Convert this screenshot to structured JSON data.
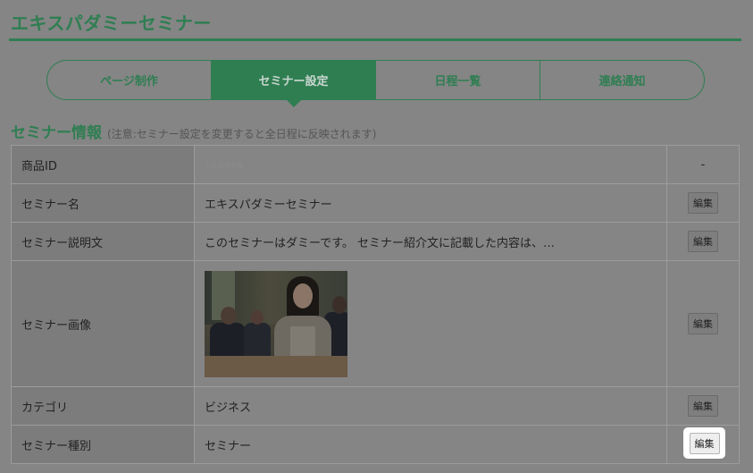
{
  "header": {
    "title": "エキスパダミーセミナー"
  },
  "tabs": [
    {
      "label": "ページ制作",
      "active": false
    },
    {
      "label": "セミナー設定",
      "active": true
    },
    {
      "label": "日程一覧",
      "active": false
    },
    {
      "label": "連絡通知",
      "active": false
    }
  ],
  "section": {
    "title": "セミナー情報",
    "note": "(注意:セミナー設定を変更すると全日程に反映されます)"
  },
  "rows": [
    {
      "label": "商品ID",
      "value": "123456",
      "action": "-"
    },
    {
      "label": "セミナー名",
      "value": "エキスパダミーセミナー",
      "action": "編集"
    },
    {
      "label": "セミナー説明文",
      "value": "このセミナーはダミーです。 セミナー紹介文に記載した内容は、…",
      "action": "編集"
    },
    {
      "label": "セミナー画像",
      "value": "",
      "action": "編集"
    },
    {
      "label": "カテゴリ",
      "value": "ビジネス",
      "action": "編集"
    },
    {
      "label": "セミナー種別",
      "value": "セミナー",
      "action": "編集"
    }
  ],
  "colors": {
    "accent": "#2f7e52",
    "overlay": "#858585",
    "highlight": "#ffffff"
  }
}
